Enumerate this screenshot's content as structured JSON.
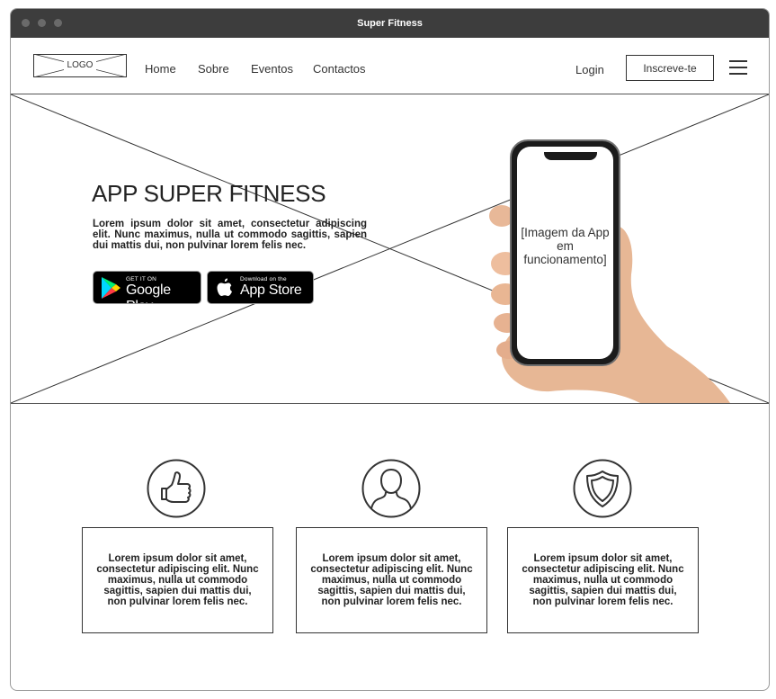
{
  "window": {
    "title": "Super Fitness"
  },
  "navbar": {
    "logo": "LOGO",
    "links": [
      "Home",
      "Sobre",
      "Eventos",
      "Contactos"
    ],
    "login": "Login",
    "signup": "Inscreve-te"
  },
  "hero": {
    "title": "APP SUPER FITNESS",
    "text": "Lorem ipsum dolor sit amet, consectetur adipiscing elit. Nunc maximus, nulla ut commodo sagittis, sapien dui mattis dui, non pulvinar lorem felis nec.",
    "google_play": {
      "small": "GET IT ON",
      "big": "Google Play"
    },
    "app_store": {
      "small": "Download on the",
      "big": "App Store"
    },
    "phone_caption": "[Imagem da App em funcionamento]"
  },
  "features": [
    {
      "icon": "thumbs-up-icon",
      "text": "Lorem ipsum dolor sit amet, consectetur adipiscing elit. Nunc maximus, nulla ut commodo sagittis, sapien dui mattis dui, non pulvinar lorem felis nec."
    },
    {
      "icon": "user-icon",
      "text": "Lorem ipsum dolor sit amet, consectetur adipiscing elit. Nunc maximus, nulla ut commodo sagittis, sapien dui mattis dui, non pulvinar lorem felis nec."
    },
    {
      "icon": "shield-icon",
      "text": "Lorem ipsum dolor sit amet, consectetur adipiscing elit. Nunc maximus, nulla ut commodo sagittis, sapien dui mattis dui, non pulvinar lorem felis nec."
    }
  ]
}
